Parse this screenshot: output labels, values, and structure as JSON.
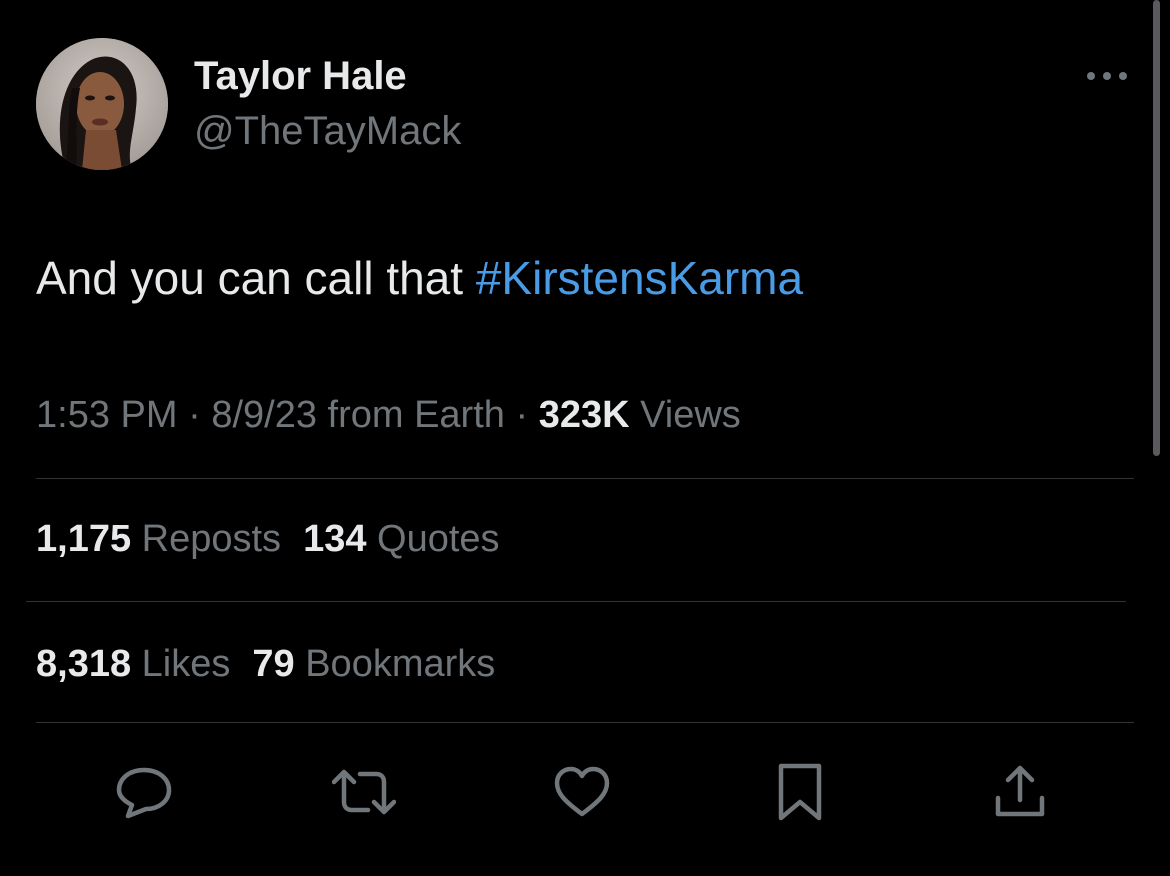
{
  "author": {
    "display_name": "Taylor Hale",
    "handle": "@TheTayMack",
    "avatar_icon": "profile-photo"
  },
  "tweet": {
    "text_prefix": "And you can call that ",
    "hashtag": "#KirstensKarma",
    "hashtag_color": "#4a9be6"
  },
  "meta": {
    "time": "1:53 PM",
    "sep1": " · ",
    "date_source": "8/9/23 from Earth",
    "sep2": " · ",
    "views_count": "323K",
    "views_label": " Views"
  },
  "stats": {
    "reposts_count": "1,175",
    "reposts_label": " Reposts",
    "quotes_count": "134",
    "quotes_label": " Quotes",
    "likes_count": "8,318",
    "likes_label": " Likes",
    "bookmarks_count": "79",
    "bookmarks_label": " Bookmarks"
  },
  "actions": {
    "reply_icon": "reply-icon",
    "repost_icon": "repost-icon",
    "like_icon": "heart-icon",
    "bookmark_icon": "bookmark-icon",
    "share_icon": "share-icon"
  },
  "colors": {
    "background": "#000000",
    "primary_text": "#e7e9ea",
    "secondary_text": "#71767b",
    "divider": "#2f3336"
  }
}
